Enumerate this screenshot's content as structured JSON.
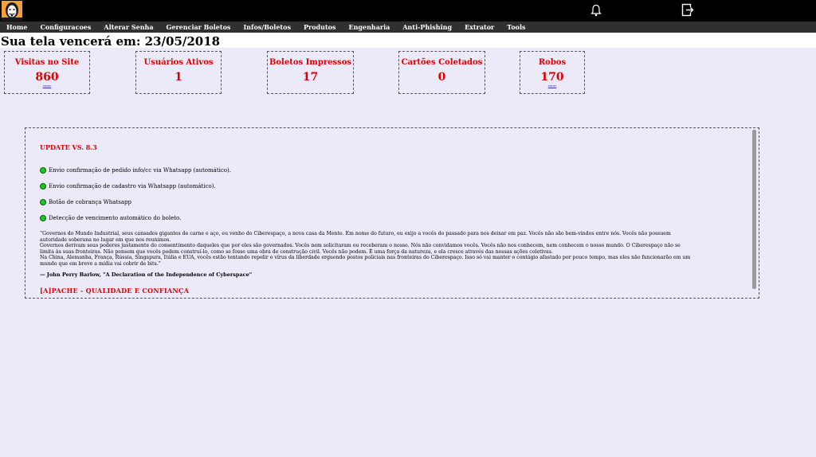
{
  "header": {
    "logo_icon": "anonymous-mask-logo",
    "bell_icon": "bell-icon",
    "logout_icon": "logout-icon"
  },
  "nav": {
    "items": [
      "Home",
      "Configuracoes",
      "Alterar Senha",
      "Gerenciar Boletos",
      "Infos/Boletos",
      "Produtos",
      "Engenharia",
      "Anti-Phishing",
      "Extrator",
      "Tools"
    ]
  },
  "expiry_text": "Sua tela vencerá em: 23/05/2018",
  "cards": [
    {
      "title": "Visitas no Site",
      "value": "860",
      "link": "zerar"
    },
    {
      "title": "Usuários Ativos",
      "value": "1"
    },
    {
      "title": "Boletos Impressos",
      "value": "17"
    },
    {
      "title": "Cartões Coletados",
      "value": "0"
    },
    {
      "title": "Robos",
      "value": "170",
      "link": "zerar"
    }
  ],
  "update": {
    "title": "UPDATE VS. 8.3",
    "features": [
      "Envio confirmação de pedido info/cc via Whatsapp (automático).",
      "Envio confirmação de cadastro via Whatsapp (automático).",
      "Botão de cobrança Whatsapp",
      "Detecção de vencimento automático do boleto."
    ],
    "quote": [
      "“Governos do Mundo Industrial, seus cansados gigantes de carne e aço, eu venho do Ciberespaço, a nova casa da Mente. Em nome do futuro, eu exijo a vocês do passado para nos deixar em paz. Vocês não são bem-vindos entre nós. Vocês não possuem autoridade soberana no lugar em que nos reunimos.",
      "Governos derivam seus poderes justamente do consentimento daqueles que por eles são governados. Vocês nem solicitaram ou receberam o nosso. Nós não convidamos vocês. Vocês não nos conhecem, nem conhecem o nosso mundo. O Ciberespaço não se limita às suas fronteiras. Não pensem que vocês podem construí-lo, como se fosse uma obra de construção civil. Vocês não podem. É uma força da natureza, e ela cresce através das nossas ações coletivas.",
      "Na China, Alemanha, França, Rússia, Singapura, Itália e EUA, vocês estão tentando repelir o vírus da liberdade erguendo postos policiais nas fronteiras do Ciberespaço. Isso só vai manter o contágio afastado por pouco tempo, mas eles não funcionarão em um mundo que em breve a mídia vai cobrir de bits.”"
    ],
    "author": "— John Perry Barlow, \"A Declaration of the Independence of Cyberspace\"",
    "slogan": "[A]PACHE - QUALIDADE E CONFIANÇA"
  },
  "colors": {
    "accent_red": "#e00000",
    "background": "#eceaf8",
    "topbar": "#000000",
    "nav": "#303030",
    "status_dot": "#1ec81e"
  }
}
